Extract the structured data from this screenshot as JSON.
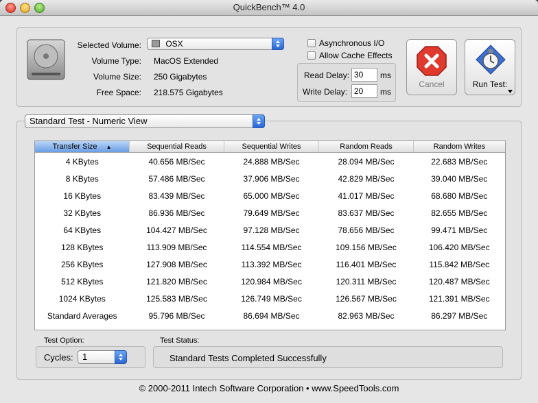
{
  "window": {
    "title": "QuickBench™ 4.0"
  },
  "volume": {
    "selected_label": "Selected Volume:",
    "selected_value": "OSX",
    "type_label": "Volume Type:",
    "type_value": "MacOS Extended",
    "size_label": "Volume Size:",
    "size_value": "250 Gigabytes",
    "free_label": "Free Space:",
    "free_value": "218.575 Gigabytes"
  },
  "options": {
    "async_label": "Asynchronous I/O",
    "cache_label": "Allow Cache Effects",
    "read_delay_label": "Read Delay:",
    "read_delay_value": "30",
    "write_delay_label": "Write Delay:",
    "write_delay_value": "20",
    "ms": "ms"
  },
  "buttons": {
    "cancel": "Cancel",
    "run": "Run Test:"
  },
  "view": {
    "selected": "Standard Test - Numeric View"
  },
  "table": {
    "headers": [
      "Transfer Size",
      "Sequential Reads",
      "Sequential Writes",
      "Random Reads",
      "Random Writes"
    ],
    "rows": [
      [
        "4 KBytes",
        "40.656 MB/Sec",
        "24.888 MB/Sec",
        "28.094 MB/Sec",
        "22.683 MB/Sec"
      ],
      [
        "8 KBytes",
        "57.486 MB/Sec",
        "37.906 MB/Sec",
        "42.829 MB/Sec",
        "39.040 MB/Sec"
      ],
      [
        "16 KBytes",
        "83.439 MB/Sec",
        "65.000 MB/Sec",
        "41.017 MB/Sec",
        "68.680 MB/Sec"
      ],
      [
        "32 KBytes",
        "86.936 MB/Sec",
        "79.649 MB/Sec",
        "83.637 MB/Sec",
        "82.655 MB/Sec"
      ],
      [
        "64 KBytes",
        "104.427 MB/Sec",
        "97.128 MB/Sec",
        "78.656 MB/Sec",
        "99.471 MB/Sec"
      ],
      [
        "128 KBytes",
        "113.909 MB/Sec",
        "114.554 MB/Sec",
        "109.156 MB/Sec",
        "106.420 MB/Sec"
      ],
      [
        "256 KBytes",
        "127.908 MB/Sec",
        "113.392 MB/Sec",
        "116.401 MB/Sec",
        "115.842 MB/Sec"
      ],
      [
        "512 KBytes",
        "121.820 MB/Sec",
        "120.984 MB/Sec",
        "120.311 MB/Sec",
        "120.487 MB/Sec"
      ],
      [
        "1024 KBytes",
        "125.583 MB/Sec",
        "126.749 MB/Sec",
        "126.567 MB/Sec",
        "121.391 MB/Sec"
      ],
      [
        "Standard Averages",
        "95.796 MB/Sec",
        "86.694 MB/Sec",
        "82.963 MB/Sec",
        "86.297 MB/Sec"
      ]
    ]
  },
  "test_option": {
    "label": "Test Option:",
    "cycles_label": "Cycles:",
    "cycles_value": "1"
  },
  "status": {
    "label": "Test Status:",
    "value": "Standard Tests Completed Successfully"
  },
  "footer": {
    "text": "© 2000-2011 Intech Software Corporation • www.SpeedTools.com"
  },
  "colors": {
    "accent": "#3b7be0",
    "cancel_red": "#e03a2e"
  }
}
